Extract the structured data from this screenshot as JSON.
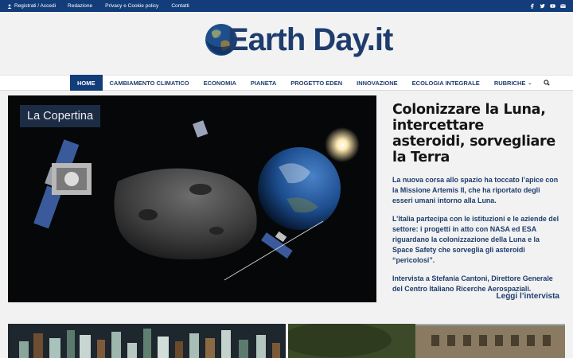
{
  "topbar": {
    "login": "Registrati / Accedi",
    "links": [
      "Redazione",
      "Privacy e Cookie policy",
      "Contatti"
    ],
    "social_icons": [
      "facebook-icon",
      "twitter-icon",
      "youtube-icon",
      "email-icon"
    ]
  },
  "logo": {
    "text": "Earth Day.it"
  },
  "nav": {
    "items": [
      "HOME",
      "CAMBIAMENTO CLIMATICO",
      "ECONOMIA",
      "PIANETA",
      "PROGETTO EDEN",
      "INNOVAZIONE",
      "ECOLOGIA INTEGRALE",
      "RUBRICHE"
    ],
    "active": "HOME"
  },
  "hero": {
    "badge": "La Copertina"
  },
  "article": {
    "title": "Colonizzare la Luna, intercettare asteroidi, sorvegliare la Terra",
    "paragraphs": [
      "La nuova corsa allo spazio ha toccato l’apice con la Missione Artemis II, che ha riportato degli esseri umani intorno alla Luna.",
      "L’Italia partecipa con le istituzioni e le aziende del settore: i progetti in atto con NASA ed ESA riguardano la colonizzazione della Luna e la Space Safety che sorveglia gli asteroidi “pericolosi”.",
      "Intervista a Stefania Cantoni, Direttore Generale del Centro Italiano Ricerche Aerospaziali."
    ],
    "read_more": "Leggi l’intervista"
  },
  "colors": {
    "brand": "#123d7a",
    "link": "#1e3d6e",
    "background": "#f2f2f2"
  }
}
